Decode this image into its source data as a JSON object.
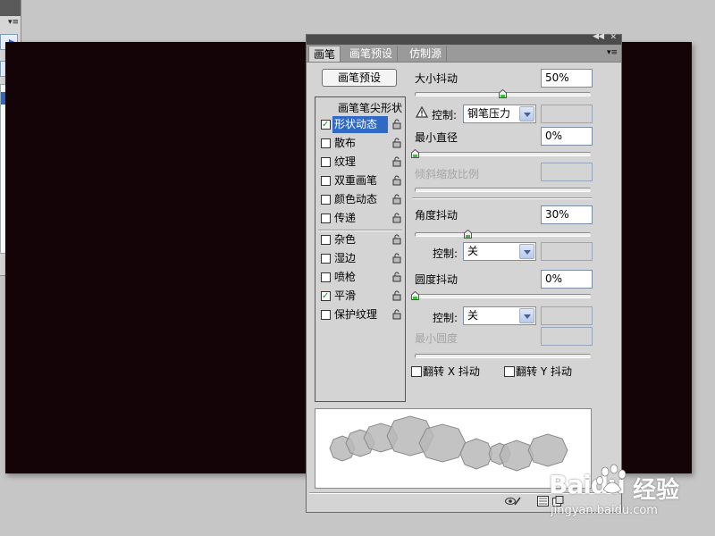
{
  "brush_panel": {
    "tabs": [
      {
        "label": "画笔",
        "active": true
      },
      {
        "label": "画笔预设",
        "active": false
      },
      {
        "label": "仿制源",
        "active": false
      }
    ],
    "preset_button": "画笔预设",
    "options_header": "画笔笔尖形状",
    "options": [
      {
        "label": "形状动态",
        "checked": true,
        "selected": true
      },
      {
        "label": "散布",
        "checked": false,
        "selected": false
      },
      {
        "label": "纹理",
        "checked": false,
        "selected": false
      },
      {
        "label": "双重画笔",
        "checked": false,
        "selected": false
      },
      {
        "label": "颜色动态",
        "checked": false,
        "selected": false
      },
      {
        "label": "传递",
        "checked": false,
        "selected": false
      },
      {
        "label": "杂色",
        "checked": false,
        "selected": false
      },
      {
        "label": "湿边",
        "checked": false,
        "selected": false
      },
      {
        "label": "喷枪",
        "checked": false,
        "selected": false
      },
      {
        "label": "平滑",
        "checked": true,
        "selected": false
      },
      {
        "label": "保护纹理",
        "checked": false,
        "selected": false
      }
    ],
    "size_jitter": {
      "label": "大小抖动",
      "value": "50%",
      "level": 0.5
    },
    "size_control": {
      "label": "控制:",
      "value": "钢笔压力"
    },
    "min_diameter": {
      "label": "最小直径",
      "value": "0%",
      "level": 0
    },
    "tilt_scale": {
      "label": "倾斜缩放比例"
    },
    "angle_jitter": {
      "label": "角度抖动",
      "value": "30%",
      "level": 0.3
    },
    "angle_control": {
      "label": "控制:",
      "value": "关"
    },
    "roundness_jitter": {
      "label": "圆度抖动",
      "value": "0%",
      "level": 0
    },
    "roundness_control": {
      "label": "控制:",
      "value": "关"
    },
    "min_roundness": {
      "label": "最小圆度"
    },
    "flip_x": {
      "label": "翻转 X 抖动",
      "checked": false
    },
    "flip_y": {
      "label": "翻转 Y 抖动",
      "checked": false
    }
  },
  "watermark": {
    "brand": "Baidu",
    "cn": "经验",
    "url": "jingyan.baidu.com"
  },
  "colors": {
    "canvas": "#140407",
    "selection": "#3169c6",
    "panel": "#d4d4d4"
  }
}
